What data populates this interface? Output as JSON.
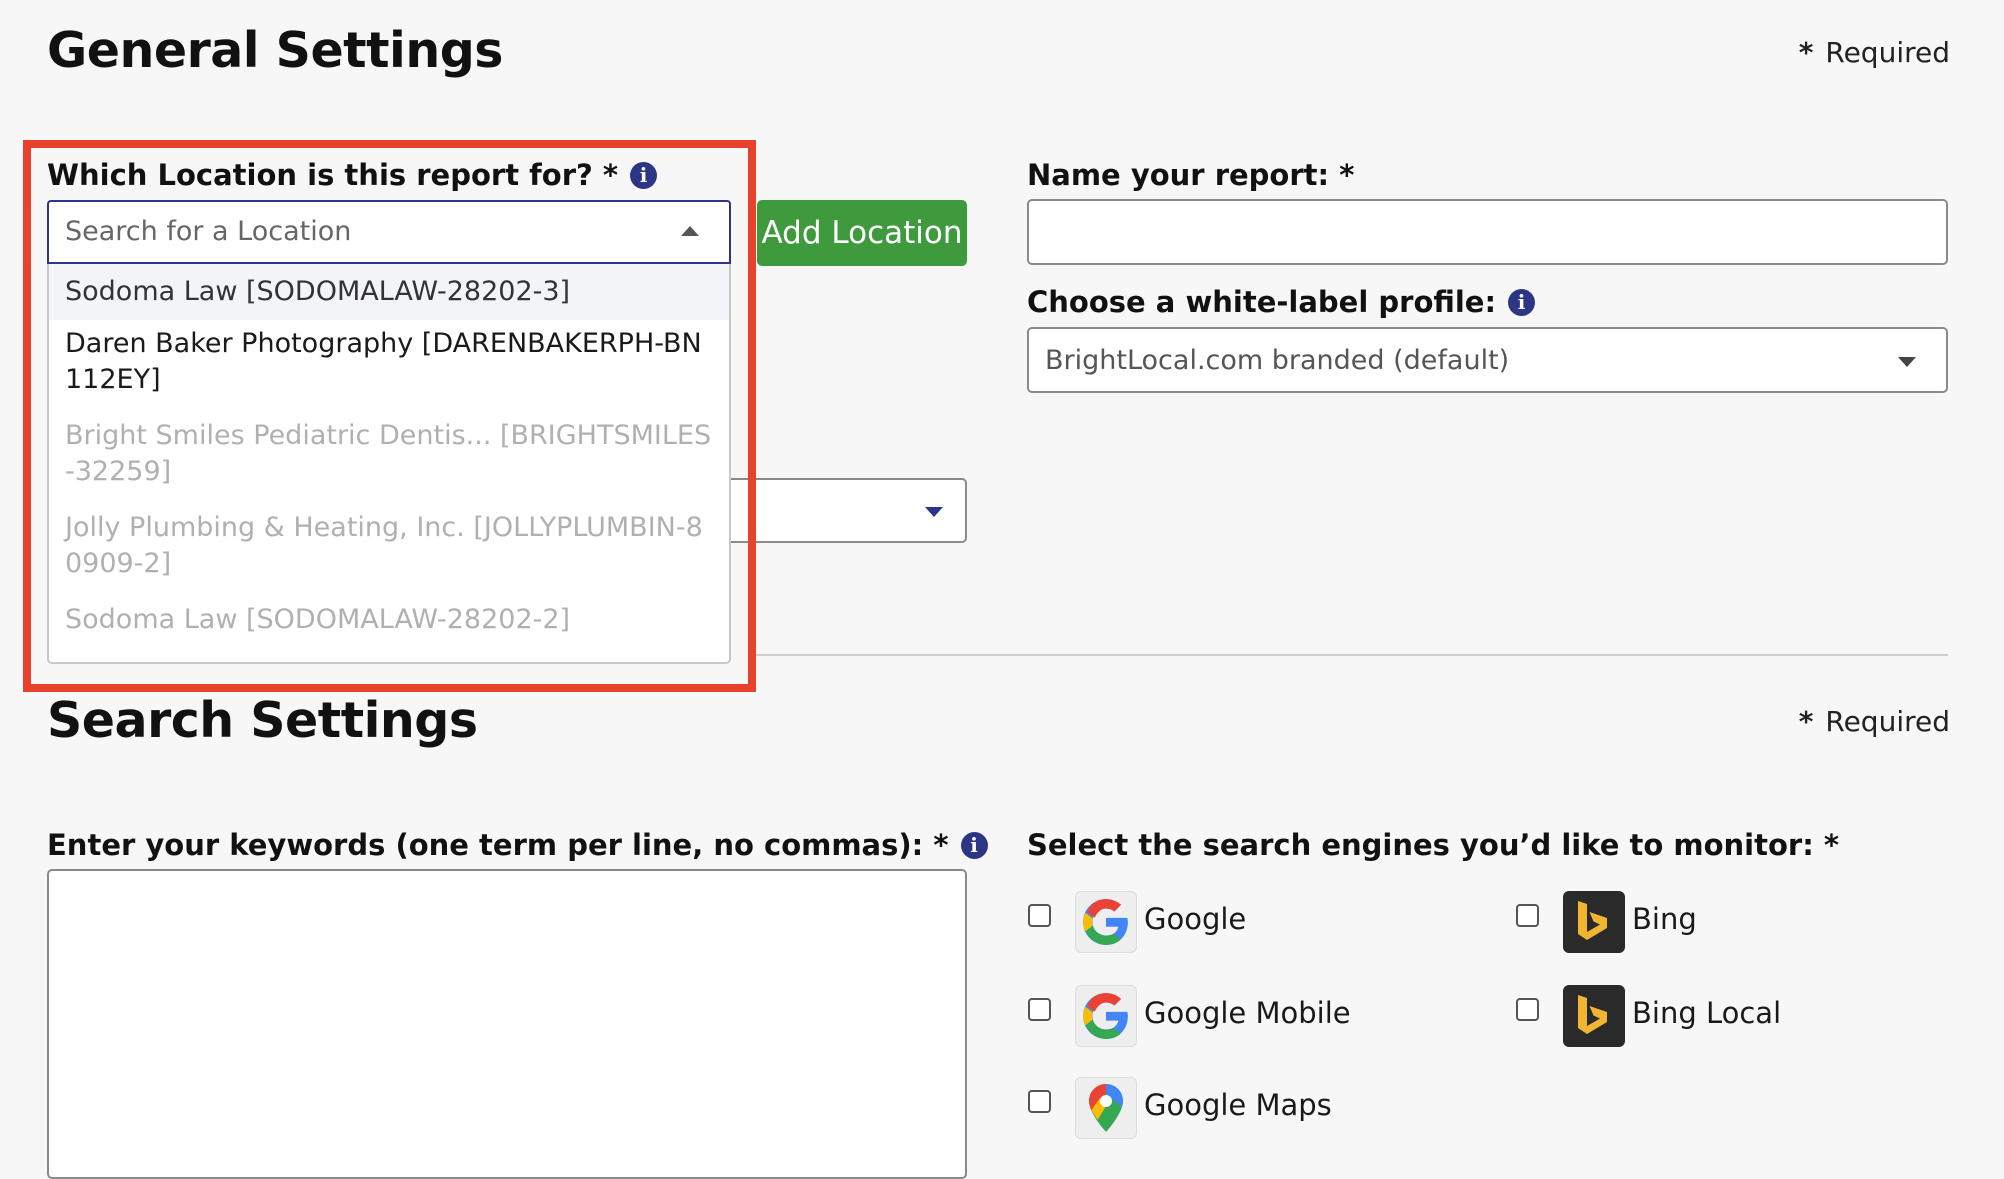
{
  "general": {
    "title": "General Settings",
    "required_star": "*",
    "required_text": "Required"
  },
  "location": {
    "label": "Which Location is this report for? *",
    "info_icon": "i",
    "search_placeholder": "Search for a Location",
    "add_button": "Add Location",
    "options": [
      {
        "label": "Sodoma Law [SODOMALAW-28202-3]",
        "state": "highlighted"
      },
      {
        "label": "Daren Baker Photography [DARENBAKERPH-BN112EY]",
        "state": "normal"
      },
      {
        "label": "Bright Smiles Pediatric Dentis... [BRIGHTSMILES-32259]",
        "state": "disabled"
      },
      {
        "label": "Jolly Plumbing & Heating, Inc. [JOLLYPLUMBIN-80909-2]",
        "state": "disabled"
      },
      {
        "label": "Sodoma Law [SODOMALAW-28202-2]",
        "state": "disabled"
      }
    ]
  },
  "report_name": {
    "label": "Name your report: *",
    "value": ""
  },
  "white_label": {
    "label": "Choose a white-label profile:",
    "info_icon": "i",
    "selected": "BrightLocal.com branded (default)"
  },
  "search": {
    "title": "Search Settings",
    "required_star": "*",
    "required_text": "Required",
    "keywords_label": "Enter your keywords (one term per line, no commas): *",
    "info_icon": "i",
    "keywords_value": "",
    "engines_label": "Select the search engines you’d like to monitor: *",
    "engines": [
      {
        "name": "Google",
        "icon": "google-icon",
        "checked": false
      },
      {
        "name": "Bing",
        "icon": "bing-icon",
        "checked": false
      },
      {
        "name": "Google Mobile",
        "icon": "google-icon",
        "checked": false
      },
      {
        "name": "Bing Local",
        "icon": "bing-icon",
        "checked": false
      },
      {
        "name": "Google Maps",
        "icon": "google-maps-icon",
        "checked": false
      }
    ]
  },
  "colors": {
    "accent_green": "#3f9a3e",
    "highlight_red": "#e8412c",
    "info_blue": "#2c3684"
  }
}
